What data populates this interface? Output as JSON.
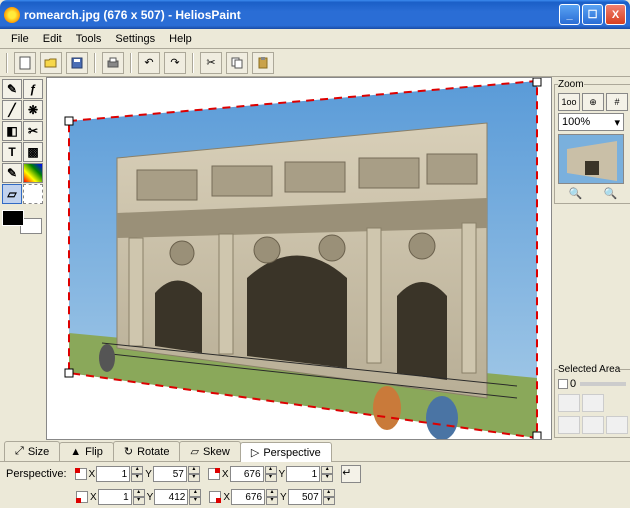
{
  "titlebar": {
    "title": "romearch.jpg (676 x 507) - HeliosPaint"
  },
  "menu": {
    "file": "File",
    "edit": "Edit",
    "tools": "Tools",
    "settings": "Settings",
    "help": "Help"
  },
  "zoom": {
    "legend": "Zoom",
    "b1": "1oo",
    "b2": "⊕",
    "b3": "#",
    "value": "100%"
  },
  "selected": {
    "legend": "Selected Area",
    "val": "0"
  },
  "tabs": {
    "size": "Size",
    "flip": "Flip",
    "rotate": "Rotate",
    "skew": "Skew",
    "perspective": "Perspective"
  },
  "perspective": {
    "label": "Perspective:",
    "tl": {
      "x": "1",
      "y": "57"
    },
    "tr": {
      "x": "676",
      "y": "1"
    },
    "bl": {
      "x": "1",
      "y": "412"
    },
    "br": {
      "x": "676",
      "y": "507"
    }
  }
}
